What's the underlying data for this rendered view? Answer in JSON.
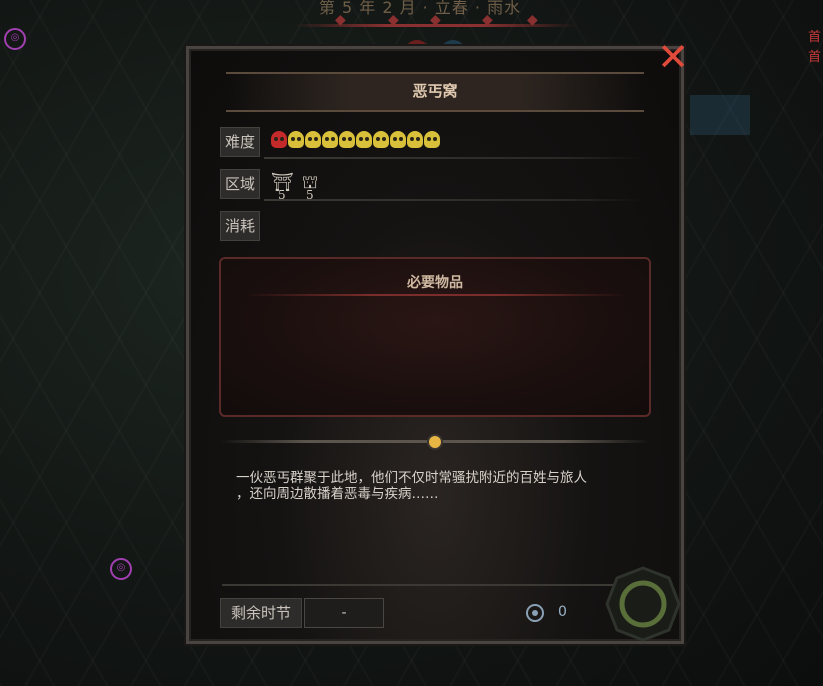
{
  "top_banner": "第 5 年 2 月 · 立春 · 雨水",
  "map_edge_text": [
    "首",
    "首"
  ],
  "dialog": {
    "title": "恶丐窝",
    "rows": {
      "difficulty_label": "难度",
      "region_label": "区域",
      "cost_label": "消耗"
    },
    "difficulty": {
      "total": 10,
      "red": 1,
      "yellow": 9
    },
    "regions": [
      {
        "icon": "shrine-icon",
        "glyph": "⛩",
        "count": "5"
      },
      {
        "icon": "gate-icon",
        "glyph": "⛫",
        "count": "5"
      }
    ],
    "required_items_title": "必要物品",
    "description_line1": "一伙恶丐群聚于此地，他们不仅时常骚扰附近的百姓与旅人",
    "description_line2": "，还向周边散播着恶毒与疾病……",
    "remaining_label": "剩余时节",
    "remaining_value": "-",
    "currency_value": "0"
  },
  "colors": {
    "skull_red": "#c42a2a",
    "skull_yellow": "#d9c03a",
    "close": "#e04a3a",
    "accent_knob": "#e6b544"
  }
}
